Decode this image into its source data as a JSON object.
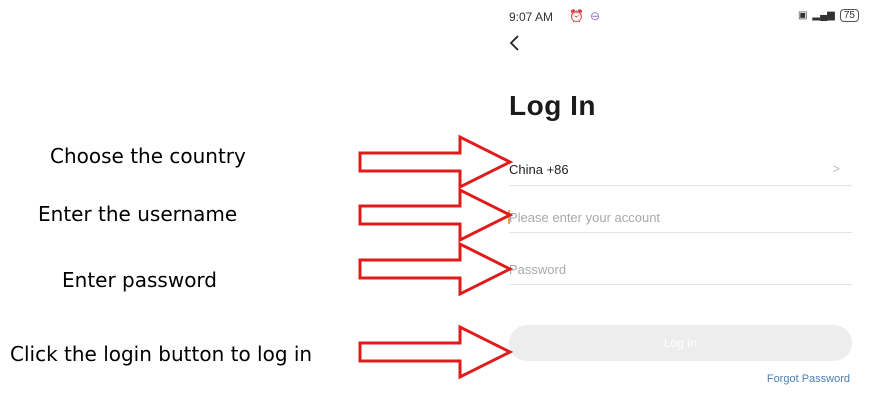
{
  "status_bar": {
    "time": "9:07 AM",
    "left_icons": [
      "alarm-icon",
      "notification-icon"
    ],
    "right_icons": [
      "sim-icon",
      "signal-icon",
      "battery-icon"
    ],
    "battery_level": "75"
  },
  "page": {
    "title": "Log In"
  },
  "form": {
    "country_value": "China +86",
    "account_placeholder": "Please enter your account",
    "password_placeholder": "Password",
    "login_button_label": "Log In",
    "forgot_password_label": "Forgot Password"
  },
  "annotations": {
    "country": "Choose the country",
    "username": "Enter the username",
    "password": "Enter password",
    "login": "Click the login button to log in"
  },
  "colors": {
    "arrow": "#e01b1b",
    "cursor": "#e2a44d",
    "link": "#4a7fb5",
    "button_disabled": "#ededed"
  }
}
